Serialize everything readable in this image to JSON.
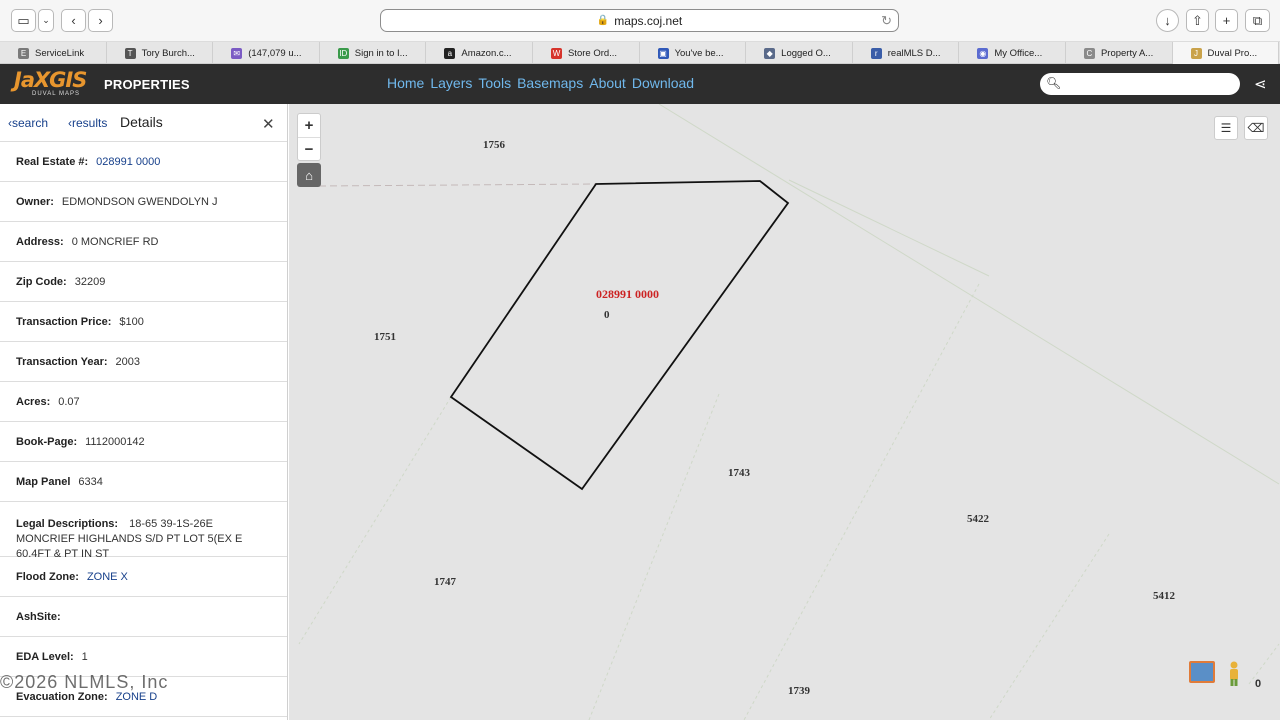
{
  "browser": {
    "url": "maps.coj.net",
    "tabs": [
      {
        "label": "ServiceLink",
        "color": "#7a7a7a",
        "glyph": "E"
      },
      {
        "label": "Tory Burch...",
        "color": "#555555",
        "glyph": "T"
      },
      {
        "label": "(147,079 u...",
        "color": "#7b5bc4",
        "glyph": "✉"
      },
      {
        "label": "Sign in to I...",
        "color": "#3a9a4a",
        "glyph": "ID"
      },
      {
        "label": "Amazon.c...",
        "color": "#222222",
        "glyph": "a"
      },
      {
        "label": "Store Ord...",
        "color": "#d6332b",
        "glyph": "W"
      },
      {
        "label": "You've be...",
        "color": "#2f58b8",
        "glyph": "▣"
      },
      {
        "label": "Logged O...",
        "color": "#5a6a8a",
        "glyph": "◆"
      },
      {
        "label": "realMLS D...",
        "color": "#3a5da8",
        "glyph": "r"
      },
      {
        "label": "My Office...",
        "color": "#5b6bd0",
        "glyph": "◉"
      },
      {
        "label": "Property A...",
        "color": "#8a8a8a",
        "glyph": "C"
      },
      {
        "label": "Duval Pro...",
        "color": "#c9a24a",
        "glyph": "J"
      }
    ]
  },
  "app": {
    "logo_text": "JaXGIS",
    "logo_sub": "DUVAL MAPS",
    "product": "PROPERTIES",
    "nav": [
      "Home",
      "Layers",
      "Tools",
      "Basemaps",
      "About",
      "Download"
    ]
  },
  "panel": {
    "back_search": "search",
    "back_results": "results",
    "title": "Details",
    "fields": {
      "re_label": "Real Estate #:",
      "re_value": "028991 0000",
      "owner_label": "Owner:",
      "owner_value": "EDMONDSON GWENDOLYN J",
      "address_label": "Address:",
      "address_value": "0 MONCRIEF RD",
      "zip_label": "Zip Code:",
      "zip_value": "32209",
      "price_label": "Transaction Price:",
      "price_value": "$100",
      "year_label": "Transaction Year:",
      "year_value": "2003",
      "acres_label": "Acres:",
      "acres_value": "0.07",
      "book_label": "Book-Page:",
      "book_value": "1112000142",
      "panel_label": "Map Panel",
      "panel_value": "6334",
      "legal_label": "Legal Descriptions:",
      "legal_value": "18-65 39-1S-26E MONCRIEF HIGHLANDS S/D PT LOT 5(EX E 60.4FT & PT IN ST",
      "flood_label": "Flood Zone:",
      "flood_value": "ZONE X",
      "ash_label": "AshSite:",
      "ash_value": "",
      "eda_label": "EDA Level:",
      "eda_value": "1",
      "evac_label": "Evacuation Zone:",
      "evac_value": "ZONE D"
    }
  },
  "map": {
    "parcel_id": "028991 0000",
    "parcel_number": "0",
    "lot_labels": [
      "1756",
      "1751",
      "1743",
      "5422",
      "1747",
      "5412",
      "1739"
    ],
    "scale_text": "0",
    "parcel_color": "#cc2222"
  },
  "watermark": "©2026 NLMLS, Inc"
}
